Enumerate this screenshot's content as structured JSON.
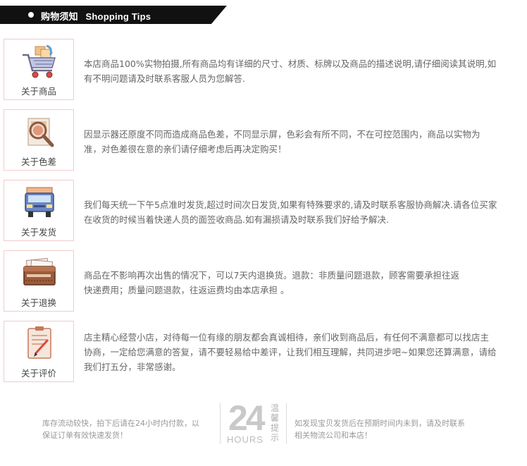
{
  "header": {
    "title_cn": "购物须知",
    "title_en": "Shopping Tips"
  },
  "tips": [
    {
      "label": "关于商品",
      "icon": "shopping-cart-icon",
      "lines": [
        "本店商品100%实物拍摄,所有商品均有详细的尺寸、材质、标牌以及商品的描述说明,请仔细阅读其说明,如",
        "有不明问题请及时联系客服人员为您解答."
      ]
    },
    {
      "label": "关于色差",
      "icon": "magnifier-icon",
      "lines": [
        "因显示器还原度不同而造成商品色差，不同显示屏，色彩会有所不同，不在可控范围内，商品以实物为",
        "准，对色差很在意的亲们请仔细考虑后再决定购买！"
      ]
    },
    {
      "label": "关于发货",
      "icon": "delivery-truck-icon",
      "lines": [
        "我们每天统一下午5点准时发货,超过时间次日发货,如果有特殊要求的,请及时联系客服协商解决.请各位买家",
        "在收货的时候当着快递人员的面签收商品.如有漏损请及时联系我们好给予解决."
      ]
    },
    {
      "label": "关于退换",
      "icon": "wallet-icon",
      "lines": [
        "商品在不影响再次出售的情况下，可以7天内退换货。退款：非质量问题退款，顾客需要承担往返",
        "快递费用；质量问题退款，往返运费均由本店承担 。"
      ]
    },
    {
      "label": "关于评价",
      "icon": "clipboard-icon",
      "lines": [
        "店主精心经营小店，对待每一位有缘的朋友都会真诚相待，亲们收到商品后，有任何不满意都可以找店主",
        "协商，一定给您满意的答复，请不要轻易给中差评，让我们相互理解，共同进步吧~如果您还算满意，请给",
        "我们打五分，非常感谢。"
      ]
    }
  ],
  "footer": {
    "left_lines": [
      "库存流动较快，拍下后请在24小时内付款，以",
      "保证订单有效快速发货！"
    ],
    "big_number": "24",
    "hours_label": "HOURS",
    "vertical_text": [
      "温",
      "馨",
      "提",
      "示"
    ],
    "right_lines": [
      "如发现宝贝发货后在预期时间内未到，请及时联系",
      "相关物流公司和本店！"
    ]
  }
}
